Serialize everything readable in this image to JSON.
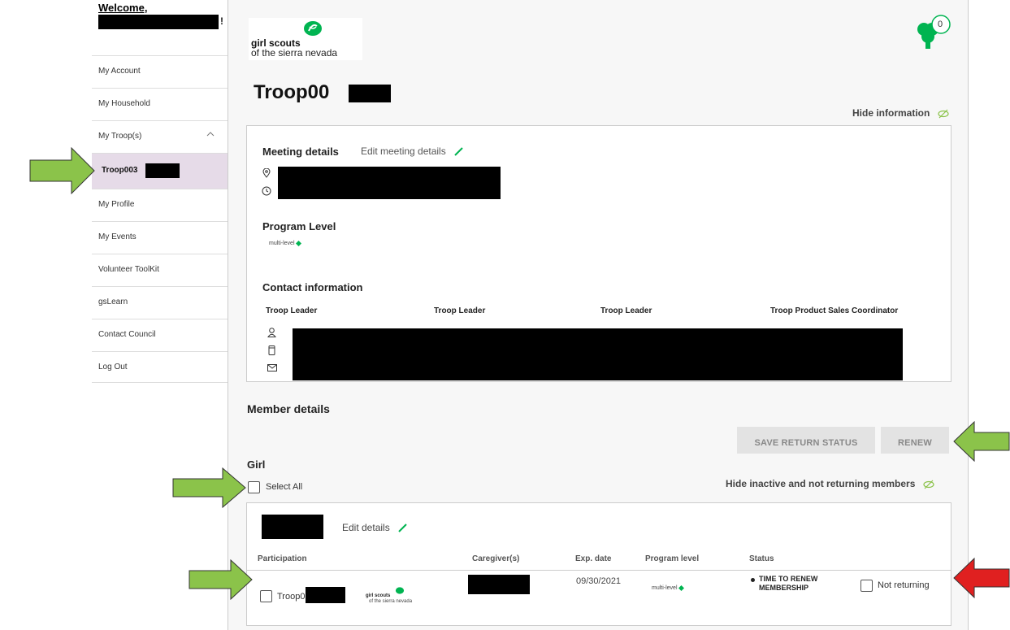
{
  "sidebar": {
    "welcome": "Welcome,",
    "welcome_suffix": "!",
    "items": [
      {
        "label": "My Account"
      },
      {
        "label": "My Household"
      },
      {
        "label": "My Troop(s)"
      },
      {
        "label": "Troop003"
      },
      {
        "label": "My Profile"
      },
      {
        "label": "My Events"
      },
      {
        "label": "Volunteer ToolKit"
      },
      {
        "label": "gsLearn"
      },
      {
        "label": "Contact Council"
      },
      {
        "label": "Log Out"
      }
    ]
  },
  "header": {
    "logo_line1": "girl scouts",
    "logo_line2": "of the sierra nevada",
    "cart_count": "0",
    "page_title": "Troop00",
    "hide_information": "Hide information"
  },
  "meeting": {
    "title": "Meeting details",
    "edit_label": "Edit meeting details",
    "program_level_title": "Program Level",
    "program_level_value": "multi-level",
    "contact_title": "Contact information",
    "contact_roles": [
      "Troop Leader",
      "Troop Leader",
      "Troop Leader",
      "Troop Product Sales Coordinator"
    ]
  },
  "members": {
    "title": "Member details",
    "save_return_status": "SAVE RETURN STATUS",
    "renew": "RENEW",
    "girl_heading": "Girl",
    "select_all": "Select All",
    "hide_inactive": "Hide inactive and not returning members",
    "edit_details": "Edit details",
    "columns": [
      "Participation",
      "Caregiver(s)",
      "Exp. date",
      "Program level",
      "Status"
    ],
    "row": {
      "participation": "Troop003",
      "exp_date": "09/30/2021",
      "program_level": "multi-level",
      "status_line1": "TIME TO RENEW",
      "status_line2": "MEMBERSHIP",
      "not_returning": "Not returning"
    }
  },
  "colors": {
    "accent_green": "#00b451",
    "arrow_green": "#8bc34a",
    "arrow_red": "#e02020",
    "active_sidebar": "#e6dbe8"
  }
}
